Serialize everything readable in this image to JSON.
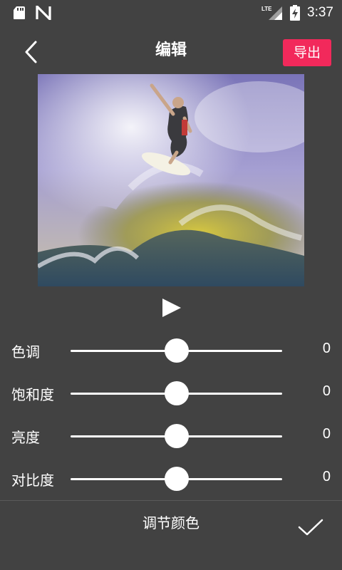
{
  "status_bar": {
    "time": "3:37",
    "network": "LTE",
    "icons": [
      "sd-card-icon",
      "n-notification-icon",
      "lte-signal-icon",
      "battery-charging-icon"
    ]
  },
  "header": {
    "title": "编辑",
    "back_icon": "back-chevron-icon",
    "export_label": "导出",
    "accent_color": "#f2295b"
  },
  "preview": {
    "description_icon": "surfer-photo",
    "play_icon": "play-icon"
  },
  "adjustments": [
    {
      "label": "色调",
      "value": "0",
      "level": 0.5
    },
    {
      "label": "饱和度",
      "value": "0",
      "level": 0.5
    },
    {
      "label": "亮度",
      "value": "0",
      "level": 0.5
    },
    {
      "label": "对比度",
      "value": "0",
      "level": 0.5
    }
  ],
  "footer": {
    "title": "调节颜色",
    "confirm_icon": "checkmark-icon"
  },
  "colors": {
    "background": "#424242",
    "text": "#ffffff"
  }
}
